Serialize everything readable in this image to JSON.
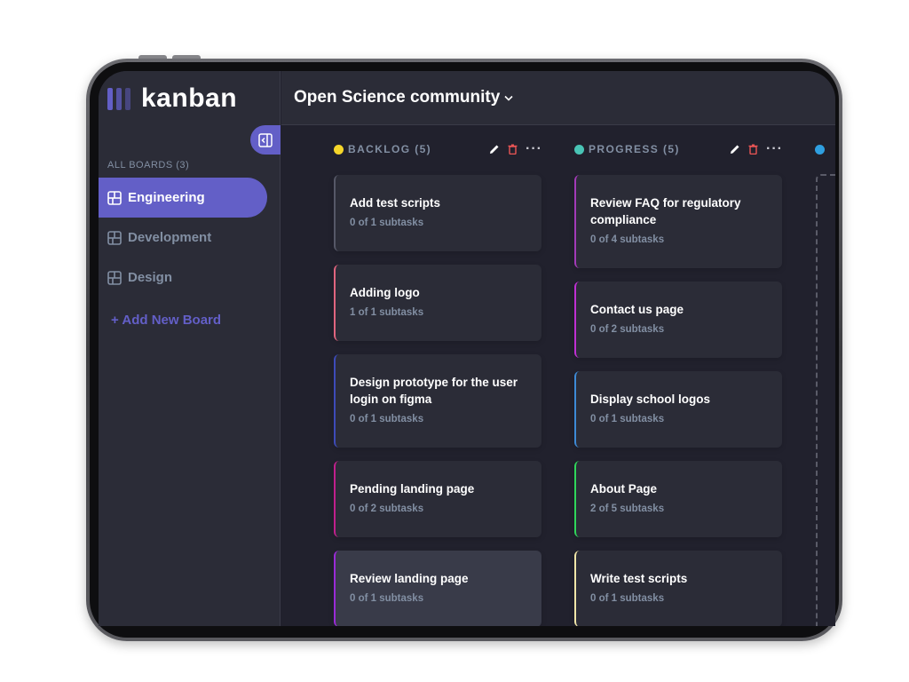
{
  "sidebar": {
    "logo": "kanban",
    "all_boards_label": "ALL BOARDS (3)",
    "boards": [
      {
        "label": "Engineering",
        "active": true
      },
      {
        "label": "Development",
        "active": false
      },
      {
        "label": "Design",
        "active": false
      }
    ],
    "add_board_label": "+ Add New Board"
  },
  "header": {
    "board_title": "Open Science community"
  },
  "colors": {
    "accent": "#635fc7",
    "background": "#21212d",
    "panel": "#2b2c37"
  },
  "columns": [
    {
      "title": "BACKLOG (5)",
      "dot_color": "#f5d62a",
      "cards": [
        {
          "title": "Add test scripts",
          "subtasks": "0 of 1 subtasks",
          "accent": "#565867"
        },
        {
          "title": "Adding logo",
          "subtasks": "1 of 1 subtasks",
          "accent": "#e0657f"
        },
        {
          "title": "Design prototype for the user login on figma",
          "subtasks": "0 of 1 subtasks",
          "accent": "#3d4bb8"
        },
        {
          "title": "Pending landing page",
          "subtasks": "0 of 2 subtasks",
          "accent": "#c0208c"
        },
        {
          "title": "Review landing page",
          "subtasks": "0 of 1 subtasks",
          "accent": "#9a2ad6"
        }
      ]
    },
    {
      "title": "PROGRESS (5)",
      "dot_color": "#49c4b5",
      "cards": [
        {
          "title": "Review FAQ for regulatory compliance",
          "subtasks": "0 of 4 subtasks",
          "accent": "#a33ab8"
        },
        {
          "title": "Contact us page",
          "subtasks": "0 of 2 subtasks",
          "accent": "#c02fd3"
        },
        {
          "title": "Display school logos",
          "subtasks": "0 of 1 subtasks",
          "accent": "#3d8ad6"
        },
        {
          "title": "About Page",
          "subtasks": "2 of 5 subtasks",
          "accent": "#2fd65a"
        },
        {
          "title": "Write test scripts",
          "subtasks": "0 of 1 subtasks",
          "accent": "#f0e6a8"
        }
      ]
    },
    {
      "title": "",
      "dot_color": "#2f9fe0"
    }
  ]
}
